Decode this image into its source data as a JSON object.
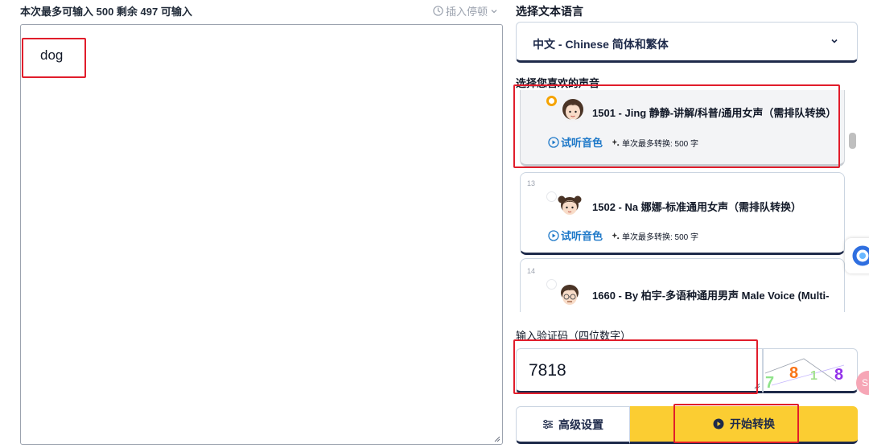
{
  "editor": {
    "counter_text": "本次最多可输入 500 剩余 497 可输入",
    "insert_pause_label": "插入停顿",
    "text_value": "dog"
  },
  "language": {
    "section_label": "选择文本语言",
    "selected": "中文 - Chinese 简体和繁体"
  },
  "voices": {
    "section_label": "选择您喜欢的声音",
    "listen_label": "试听音色",
    "items": [
      {
        "index": "",
        "name": "1501 - Jing 静静-讲解/科普/通用女声（需排队转换）",
        "max_chars": "单次最多转换: 500 字",
        "selected": true
      },
      {
        "index": "13",
        "name": "1502 - Na 娜娜-标准通用女声（需排队转换）",
        "max_chars": "单次最多转换: 500 字",
        "selected": false
      },
      {
        "index": "14",
        "name": "1660 - By 柏宇-多语种通用男声 Male Voice (Multi-",
        "max_chars": "",
        "selected": false
      }
    ]
  },
  "captcha": {
    "label": "输入验证码（四位数字）",
    "value": "7818",
    "image_digits": [
      "7",
      "8",
      "1",
      "8"
    ]
  },
  "actions": {
    "advanced_label": "高级设置",
    "start_label": "开始转换"
  },
  "colors": {
    "accent_yellow": "#fbcd32",
    "navy": "#1e2a4a",
    "link_blue": "#1d78c8",
    "highlight_red": "#e11d2b"
  }
}
